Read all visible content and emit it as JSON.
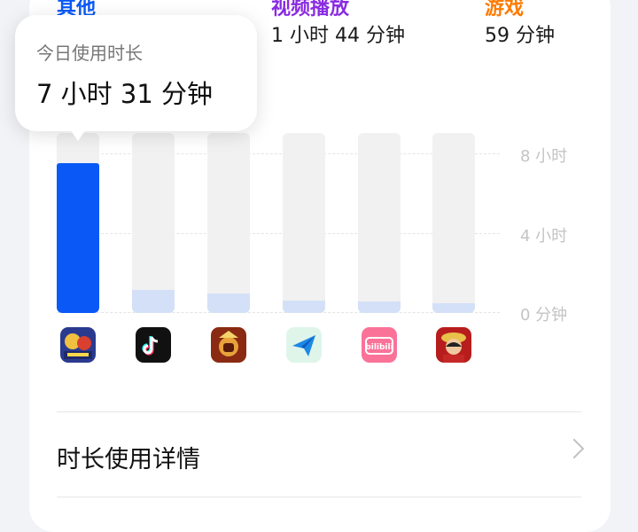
{
  "categories": [
    {
      "name": "其他",
      "value": ""
    },
    {
      "name": "视频播放",
      "value": "1 小时 44 分钟"
    },
    {
      "name": "游戏",
      "value": "59 分钟"
    }
  ],
  "tooltip": {
    "title": "今日使用时长",
    "value": "7 小时 31 分钟"
  },
  "chart_data": {
    "type": "bar",
    "y_ticks": [
      "8 小时",
      "4 小时",
      "0 分钟"
    ],
    "ylim_hours": [
      0,
      8
    ],
    "categories": [
      "app-1",
      "douyin",
      "honor-of-kings",
      "feishu",
      "bilibili",
      "one-piece-game"
    ],
    "values_hours": [
      7.52,
      1.1,
      0.95,
      0.6,
      0.55,
      0.45
    ],
    "selected_index": 0
  },
  "apps": [
    {
      "icon": "game-app-icon"
    },
    {
      "icon": "tiktok-icon"
    },
    {
      "icon": "moba-game-icon"
    },
    {
      "icon": "paper-plane-icon"
    },
    {
      "icon": "bilibili-icon"
    },
    {
      "icon": "one-piece-icon"
    }
  ],
  "icon_labels": {
    "bilibili": "bilibili"
  },
  "details": {
    "label": "时长使用详情"
  },
  "colors": {
    "active_bar": "#0a59f7",
    "idle_bar": "#d3e0f7",
    "track": "#f1f1f1"
  }
}
